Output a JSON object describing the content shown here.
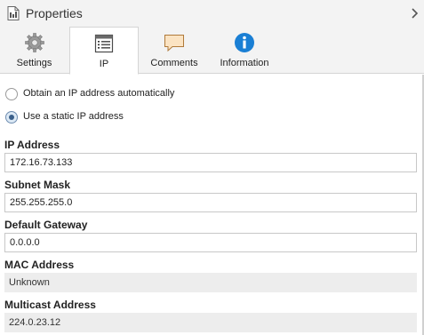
{
  "header": {
    "title": "Properties",
    "title_icon": "document-properties-icon",
    "collapse_icon": "chevron-right-icon"
  },
  "tabs": [
    {
      "label": "Settings",
      "icon": "gear-icon",
      "active": false
    },
    {
      "label": "IP",
      "icon": "window-list-icon",
      "active": true
    },
    {
      "label": "Comments",
      "icon": "speech-bubble-icon",
      "active": false
    },
    {
      "label": "Information",
      "icon": "info-icon",
      "active": false
    }
  ],
  "ip_mode": {
    "option_auto": "Obtain an IP address automatically",
    "option_static": "Use a static IP address",
    "selected": "static"
  },
  "fields": {
    "ip_address": {
      "label": "IP Address",
      "value": "172.16.73.133"
    },
    "subnet_mask": {
      "label": "Subnet Mask",
      "value": "255.255.255.0"
    },
    "default_gateway": {
      "label": "Default Gateway",
      "value": "0.0.0.0"
    },
    "mac_address": {
      "label": "MAC Address",
      "value": "Unknown"
    },
    "multicast_address": {
      "label": "Multicast Address",
      "value": "224.0.23.12"
    }
  },
  "colors": {
    "accent_blue": "#1a7fd4",
    "panel_bg": "#f3f3f3",
    "readonly_bg": "#ededed"
  }
}
